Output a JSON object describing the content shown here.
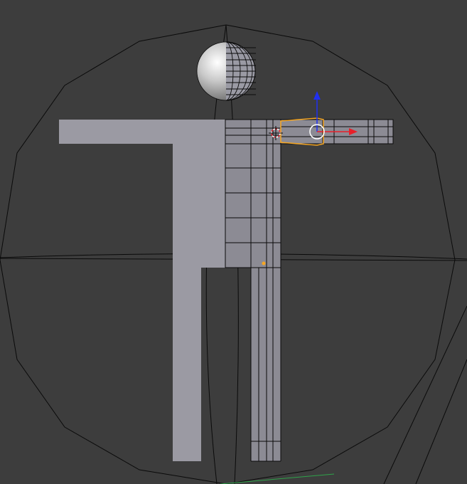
{
  "viewport": {
    "background_color": "#3d3d3d",
    "mesh_fill_color": "#9b9aa3",
    "wire_color": "#0a0a0a",
    "selected_color": "#f5a623",
    "gizmo_x_color": "#e8202a",
    "gizmo_z_color": "#2030f0",
    "ground_line_color": "#2fa34a"
  },
  "icons": {
    "sphere": "sphere-icon",
    "cursor": "3d-cursor-icon",
    "gizmo": "transform-gizmo-icon"
  }
}
